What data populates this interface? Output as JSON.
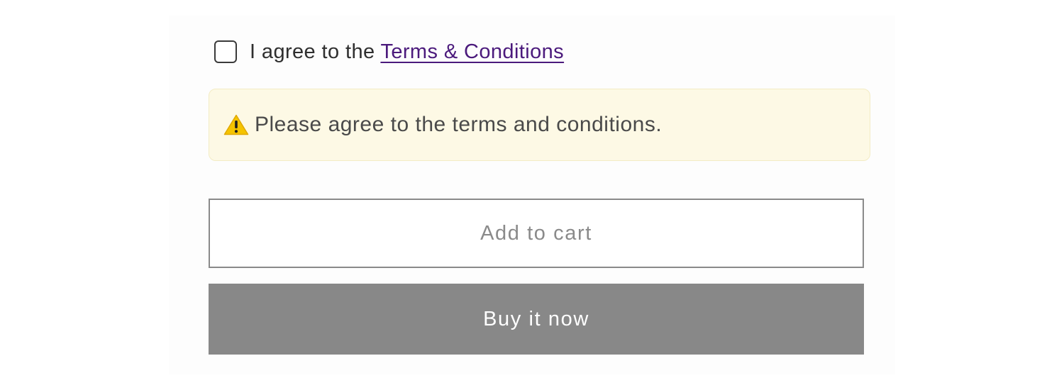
{
  "terms": {
    "checked": false,
    "prefix": "I agree to the ",
    "link_text": "Terms & Conditions"
  },
  "warning": {
    "icon": "warning-triangle-icon",
    "message": "Please agree to the terms and conditions."
  },
  "buttons": {
    "add_to_cart": "Add to cart",
    "buy_now": "Buy it now"
  },
  "colors": {
    "link": "#4b1a7c",
    "warning_bg": "#fdf9e5",
    "warning_icon": "#f5c400",
    "disabled_button": "#888888"
  }
}
